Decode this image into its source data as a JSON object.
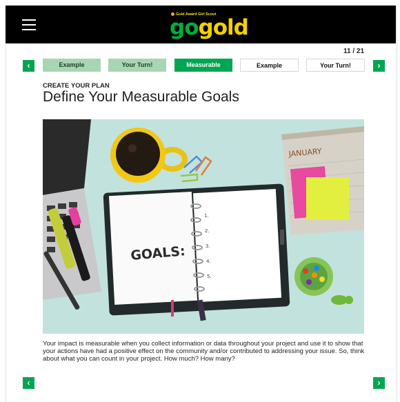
{
  "header": {
    "logo_tagline": "Gold Award Girl Scout",
    "logo_go": "go",
    "logo_gold": "gold",
    "colors": {
      "background": "#000000",
      "go": "#00ae3e",
      "gold": "#f3d000"
    }
  },
  "progress": {
    "label": "11 / 21",
    "current": 11,
    "total": 21
  },
  "tabs": [
    {
      "label": "Example",
      "state": "completed"
    },
    {
      "label": "Your Turn!",
      "state": "completed"
    },
    {
      "label": "Measurable",
      "state": "active"
    },
    {
      "label": "Example",
      "state": "upcoming"
    },
    {
      "label": "Your Turn!",
      "state": "upcoming"
    }
  ],
  "content": {
    "eyebrow": "CREATE YOUR PLAN",
    "title": "Define Your Measurable Goals",
    "image": {
      "planner_text": "GOALS:",
      "calendar_month": "JANUARY",
      "list_numbers": [
        "1.",
        "2.",
        "3.",
        "4.",
        "5."
      ]
    },
    "body": "Your impact is measurable when you collect information or data throughout your project and use it to show that your actions have had a positive effect on the community and/or contributed to addressing your issue. So, think about what you can count in your project. How much? How many?"
  },
  "nav": {
    "prev_icon": "chevron-left-icon",
    "next_icon": "chevron-right-icon",
    "accent": "#00a651"
  }
}
